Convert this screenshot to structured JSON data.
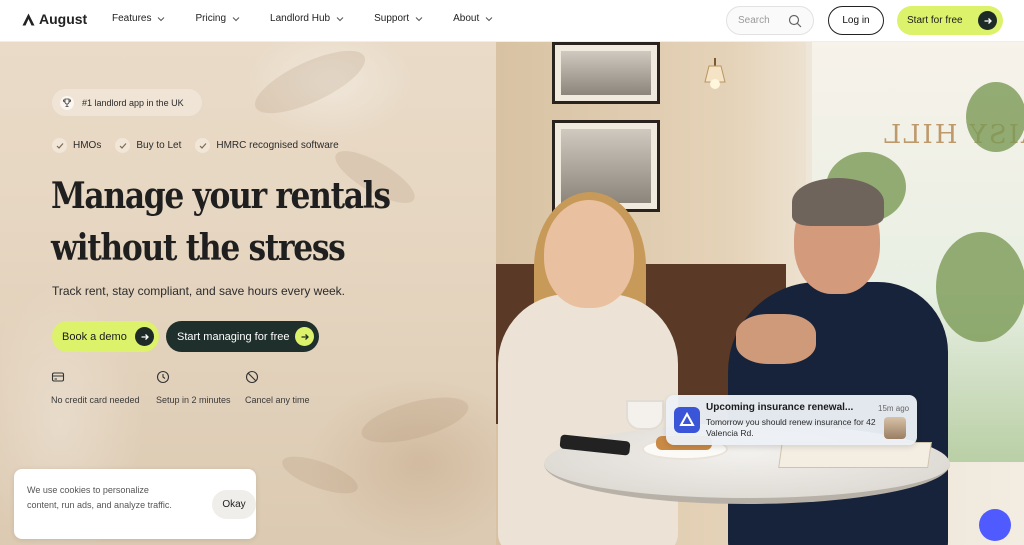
{
  "brand": {
    "name": "August"
  },
  "nav": {
    "items": [
      {
        "label": "Features"
      },
      {
        "label": "Pricing"
      },
      {
        "label": "Landlord Hub"
      },
      {
        "label": "Support"
      },
      {
        "label": "About"
      }
    ],
    "search_placeholder": "Search",
    "login_label": "Log in",
    "cta_label": "Start for free"
  },
  "hero": {
    "award": "#1 landlord app in the UK",
    "features": [
      "HMOs",
      "Buy to Let",
      "HMRC recognised software"
    ],
    "headline_line1": "Manage your rentals",
    "headline_line2": "without the stress",
    "subheading": "Track rent, stay compliant, and save hours every week.",
    "demo_label": "Book a demo",
    "start_label": "Start managing for free",
    "perks": [
      "No credit card needed",
      "Setup in 2 minutes",
      "Cancel any time"
    ]
  },
  "notification": {
    "title": "Upcoming insurance renewal...",
    "time": "15m ago",
    "body": "Tomorrow you should renew insurance for 42 Valencia Rd."
  },
  "photo": {
    "window_sign": "THE DAISY HILL"
  },
  "cookie": {
    "text": "We use cookies to personalize content, run ads, and analyze traffic.",
    "ok_label": "Okay"
  },
  "colors": {
    "accent": "#dcf26b",
    "dark": "#1f2f2b",
    "chat": "#4f5bff"
  }
}
